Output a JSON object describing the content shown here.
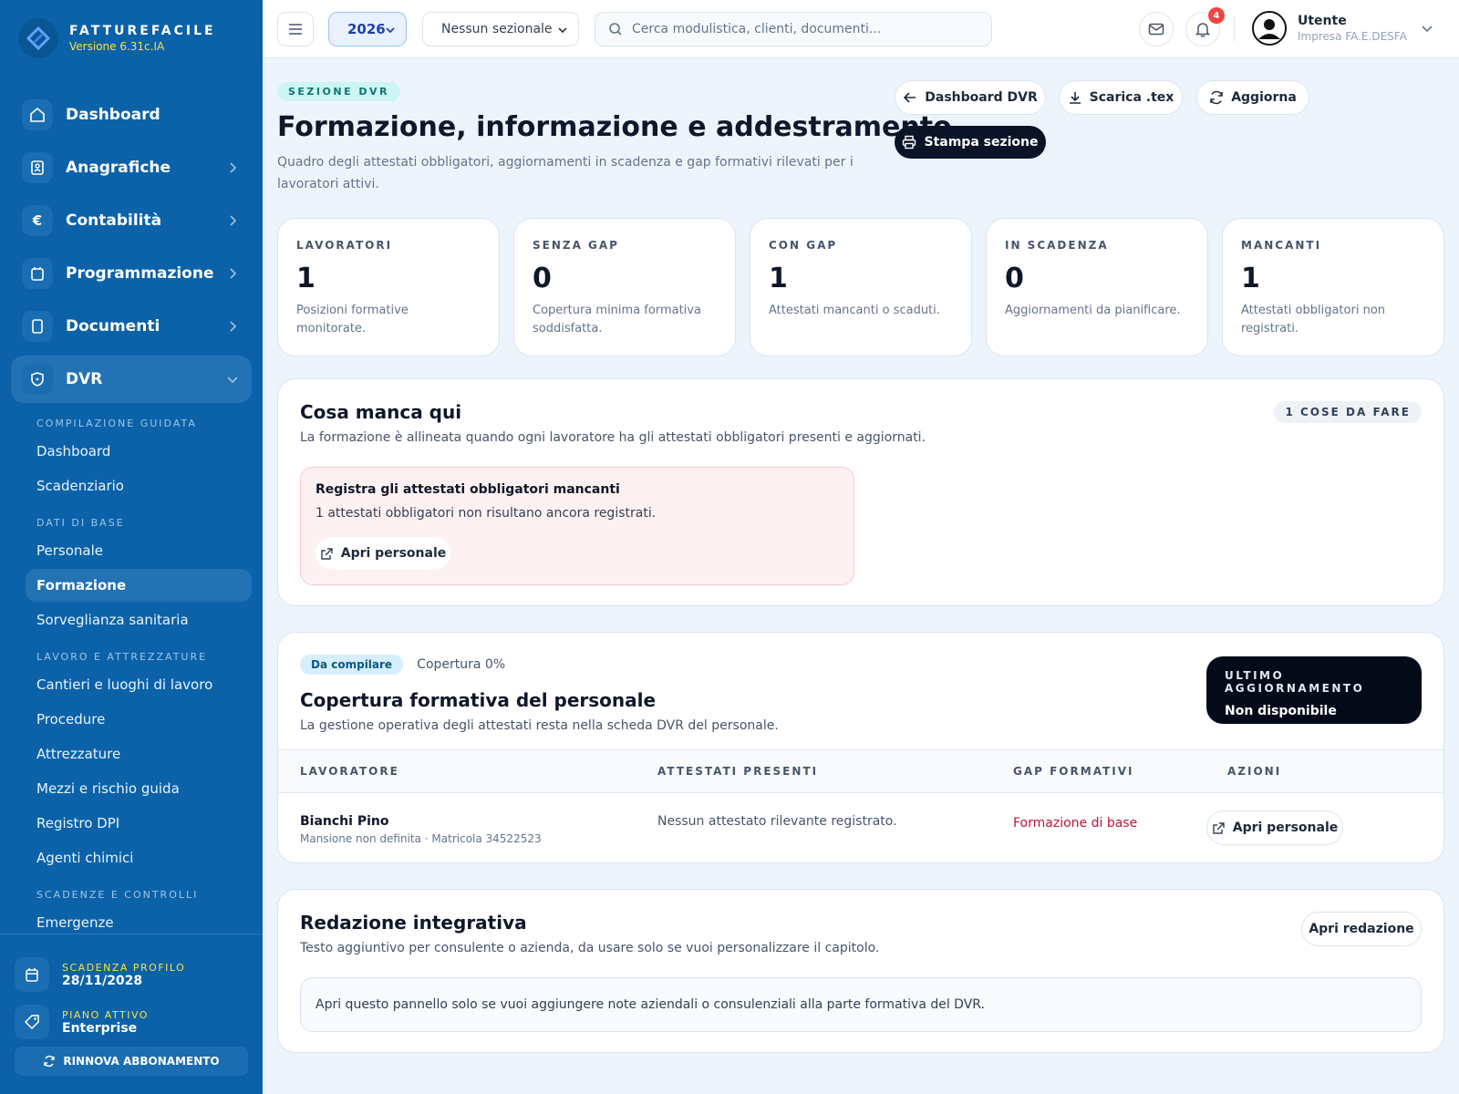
{
  "brand": {
    "name": "FATTUREFACILE",
    "version": "Versione 6.31c.IA"
  },
  "nav": [
    {
      "label": "Dashboard",
      "icon": "home-icon"
    },
    {
      "label": "Anagrafiche",
      "icon": "contacts-icon"
    },
    {
      "label": "Contabilità",
      "icon": "euro-icon"
    },
    {
      "label": "Programmazione",
      "icon": "calendar-icon"
    },
    {
      "label": "Documenti",
      "icon": "document-icon"
    },
    {
      "label": "DVR",
      "icon": "shield-icon"
    }
  ],
  "dvr_menu": {
    "section1": "COMPILAZIONE GUIDATA",
    "item1": "Dashboard",
    "item2": "Scadenziario",
    "section2": "DATI DI BASE",
    "item3": "Personale",
    "item4": "Formazione",
    "item5": "Sorveglianza sanitaria",
    "section3": "LAVORO E ATTREZZATURE",
    "item6": "Cantieri e luoghi di lavoro",
    "item7": "Procedure",
    "item8": "Attrezzature",
    "item9": "Mezzi e rischio guida",
    "item10": "Registro DPI",
    "item11": "Agenti chimici",
    "section4": "SCADENZE E CONTROLLI",
    "item12": "Emergenze"
  },
  "footer": {
    "profile_label": "SCADENZA PROFILO",
    "profile_value": "28/11/2028",
    "plan_label": "PIANO ATTIVO",
    "plan_value": "Enterprise",
    "renew": "RINNOVA ABBONAMENTO"
  },
  "header": {
    "year": "2026",
    "section": "Nessun sezionale",
    "search_placeholder": "Cerca modulistica, clienti, documenti...",
    "notifications": "4",
    "user_name": "Utente",
    "user_company": "Impresa FA.E.DESFA"
  },
  "page": {
    "eyebrow": "SEZIONE DVR",
    "title": "Formazione, informazione e addestramento",
    "subtitle": "Quadro degli attestati obbligatori, aggiornamenti in scadenza e gap formativi rilevati per i lavoratori attivi.",
    "btn_dashboard": "Dashboard DVR",
    "btn_download": "Scarica .tex",
    "btn_refresh": "Aggiorna",
    "btn_print": "Stampa sezione"
  },
  "stats": [
    {
      "label": "LAVORATORI",
      "value": "1",
      "desc": "Posizioni formative monitorate."
    },
    {
      "label": "SENZA GAP",
      "value": "0",
      "desc": "Copertura minima formativa soddisfatta."
    },
    {
      "label": "CON GAP",
      "value": "1",
      "desc": "Attestati mancanti o scaduti."
    },
    {
      "label": "IN SCADENZA",
      "value": "0",
      "desc": "Aggiornamenti da pianificare."
    },
    {
      "label": "MANCANTI",
      "value": "1",
      "desc": "Attestati obbligatori non registrati."
    }
  ],
  "todo": {
    "title": "Cosa manca qui",
    "subtitle": "La formazione è allineata quando ogni lavoratore ha gli attestati obbligatori presenti e aggiornati.",
    "count": "1 COSE DA FARE",
    "alert_title": "Registra gli attestati obbligatori mancanti",
    "alert_text": "1 attestati obbligatori non risultano ancora registrati.",
    "alert_button": "Apri personale"
  },
  "coverage": {
    "status": "Da compilare",
    "percent": "Copertura 0%",
    "title": "Copertura formativa del personale",
    "subtitle": "La gestione operativa degli attestati resta nella scheda DVR del personale.",
    "last_update_label": "ULTIMO AGGIORNAMENTO",
    "last_update_value": "Non disponibile",
    "columns": [
      "LAVORATORE",
      "ATTESTATI PRESENTI",
      "GAP FORMATIVI",
      "AZIONI"
    ],
    "rows": [
      {
        "name": "Bianchi Pino",
        "meta": "Mansione non definita · Matricola 34522523",
        "certificates": "Nessun attestato rilevante registrato.",
        "gap": "Formazione di base",
        "action": "Apri personale"
      }
    ]
  },
  "integrative": {
    "title": "Redazione integrativa",
    "subtitle": "Testo aggiuntivo per consulente o azienda, da usare solo se vuoi personalizzare il capitolo.",
    "button": "Apri redazione",
    "box_text": "Apri questo pannello solo se vuoi aggiungere note aziendali o consulenziali alla parte formativa del DVR."
  },
  "colors": {
    "sidebar": "#0b62a8",
    "accent_yellow": "#fde047",
    "danger": "#be123c",
    "dark": "#0b1426"
  }
}
